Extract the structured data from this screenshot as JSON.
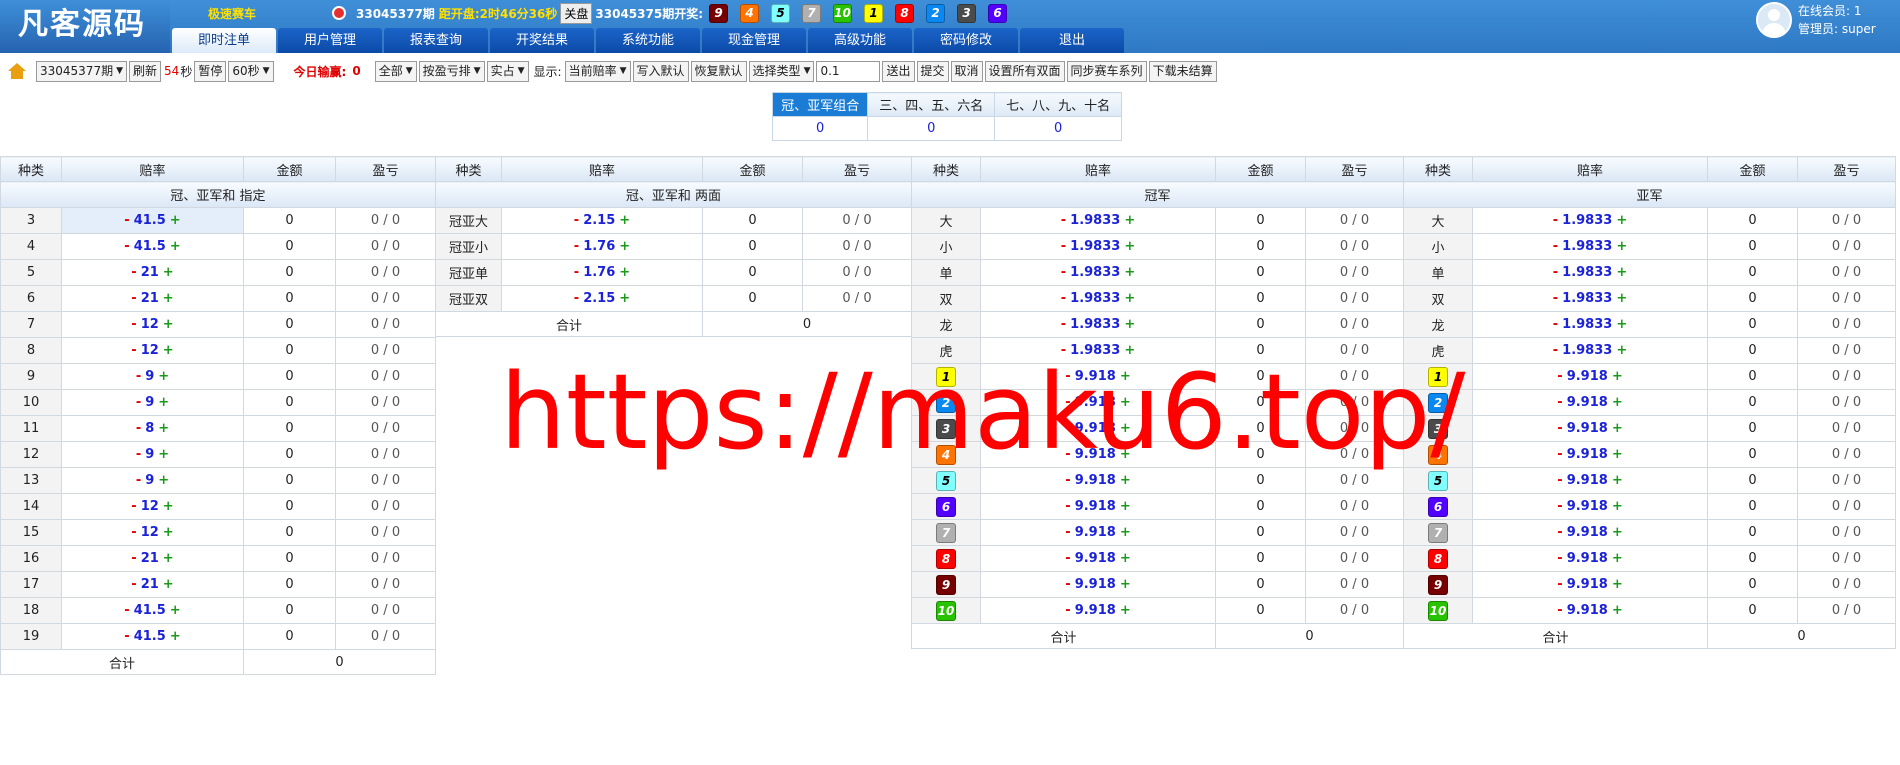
{
  "brand": {
    "logo_text": "凡客源码"
  },
  "infobar": {
    "game_name": "极速赛车",
    "current_period": "33045377期",
    "countdown_label": "距开盘:",
    "countdown": "2时46分36秒",
    "closed_badge": "关盘",
    "last_period": "33045375期开奖:",
    "last_result": [
      9,
      4,
      5,
      7,
      10,
      1,
      8,
      2,
      3,
      6
    ]
  },
  "tabs": [
    "即时注单",
    "用户管理",
    "报表查询",
    "开奖结果",
    "系统功能",
    "现金管理",
    "高级功能",
    "密码修改",
    "退出"
  ],
  "user": {
    "online": "在线会员: 1",
    "admin": "管理员: super"
  },
  "toolbar": {
    "period_select": "33045377期",
    "refresh": "刷新",
    "countdown_num": "54",
    "countdown_unit": "秒",
    "pause": "暂停",
    "interval_select": "60秒",
    "today_label": "今日输赢:",
    "today_value": "0",
    "scope_select": "全部",
    "sort_select": "按盈亏排",
    "mode_select": "实占",
    "display_label": "显示:",
    "odds_select": "当前赔率",
    "write_default": "写入默认",
    "restore_default": "恢复默认",
    "type_select": "选择类型",
    "step_value": "0.1",
    "send": "送出",
    "submit": "提交",
    "cancel": "取消",
    "set_all_double": "设置所有双面",
    "sync_series": "同步赛车系列",
    "download_unsettled": "下载未结算"
  },
  "summary": {
    "headers": [
      "冠、亚军组合",
      "三、四、五、六名",
      "七、八、九、十名"
    ],
    "values": [
      "0",
      "0",
      "0"
    ]
  },
  "columns": {
    "kind": "种类",
    "odds": "赔率",
    "amount": "金额",
    "pnl": "盈亏"
  },
  "total_label": "合计",
  "panels": [
    {
      "title": "冠、亚军和 指定",
      "total": "0",
      "rows": [
        {
          "k": "3",
          "o": "41.5",
          "a": "0",
          "w": "0 / 0"
        },
        {
          "k": "4",
          "o": "41.5",
          "a": "0",
          "w": "0 / 0"
        },
        {
          "k": "5",
          "o": "21",
          "a": "0",
          "w": "0 / 0"
        },
        {
          "k": "6",
          "o": "21",
          "a": "0",
          "w": "0 / 0"
        },
        {
          "k": "7",
          "o": "12",
          "a": "0",
          "w": "0 / 0"
        },
        {
          "k": "8",
          "o": "12",
          "a": "0",
          "w": "0 / 0"
        },
        {
          "k": "9",
          "o": "9",
          "a": "0",
          "w": "0 / 0"
        },
        {
          "k": "10",
          "o": "9",
          "a": "0",
          "w": "0 / 0"
        },
        {
          "k": "11",
          "o": "8",
          "a": "0",
          "w": "0 / 0"
        },
        {
          "k": "12",
          "o": "9",
          "a": "0",
          "w": "0 / 0"
        },
        {
          "k": "13",
          "o": "9",
          "a": "0",
          "w": "0 / 0"
        },
        {
          "k": "14",
          "o": "12",
          "a": "0",
          "w": "0 / 0"
        },
        {
          "k": "15",
          "o": "12",
          "a": "0",
          "w": "0 / 0"
        },
        {
          "k": "16",
          "o": "21",
          "a": "0",
          "w": "0 / 0"
        },
        {
          "k": "17",
          "o": "21",
          "a": "0",
          "w": "0 / 0"
        },
        {
          "k": "18",
          "o": "41.5",
          "a": "0",
          "w": "0 / 0"
        },
        {
          "k": "19",
          "o": "41.5",
          "a": "0",
          "w": "0 / 0"
        }
      ]
    },
    {
      "title": "冠、亚军和 两面",
      "total": "0",
      "rows": [
        {
          "k": "冠亚大",
          "o": "2.15",
          "a": "0",
          "w": "0 / 0"
        },
        {
          "k": "冠亚小",
          "o": "1.76",
          "a": "0",
          "w": "0 / 0"
        },
        {
          "k": "冠亚单",
          "o": "1.76",
          "a": "0",
          "w": "0 / 0"
        },
        {
          "k": "冠亚双",
          "o": "2.15",
          "a": "0",
          "w": "0 / 0"
        }
      ]
    },
    {
      "title": "冠军",
      "total": "0",
      "rows": [
        {
          "k": "大",
          "o": "1.9833",
          "a": "0",
          "w": "0 / 0"
        },
        {
          "k": "小",
          "o": "1.9833",
          "a": "0",
          "w": "0 / 0"
        },
        {
          "k": "单",
          "o": "1.9833",
          "a": "0",
          "w": "0 / 0"
        },
        {
          "k": "双",
          "o": "1.9833",
          "a": "0",
          "w": "0 / 0"
        },
        {
          "k": "龙",
          "o": "1.9833",
          "a": "0",
          "w": "0 / 0"
        },
        {
          "k": "虎",
          "o": "1.9833",
          "a": "0",
          "w": "0 / 0"
        },
        {
          "ball": 1,
          "o": "9.918",
          "a": "0",
          "w": "0 / 0"
        },
        {
          "ball": 2,
          "o": "9.918",
          "a": "0",
          "w": "0 / 0"
        },
        {
          "ball": 3,
          "o": "9.918",
          "a": "0",
          "w": "0 / 0"
        },
        {
          "ball": 4,
          "o": "9.918",
          "a": "0",
          "w": "0 / 0"
        },
        {
          "ball": 5,
          "o": "9.918",
          "a": "0",
          "w": "0 / 0"
        },
        {
          "ball": 6,
          "o": "9.918",
          "a": "0",
          "w": "0 / 0"
        },
        {
          "ball": 7,
          "o": "9.918",
          "a": "0",
          "w": "0 / 0"
        },
        {
          "ball": 8,
          "o": "9.918",
          "a": "0",
          "w": "0 / 0"
        },
        {
          "ball": 9,
          "o": "9.918",
          "a": "0",
          "w": "0 / 0"
        },
        {
          "ball": 10,
          "o": "9.918",
          "a": "0",
          "w": "0 / 0"
        }
      ]
    },
    {
      "title": "亚军",
      "total": "0",
      "rows": [
        {
          "k": "大",
          "o": "1.9833",
          "a": "0",
          "w": "0 / 0"
        },
        {
          "k": "小",
          "o": "1.9833",
          "a": "0",
          "w": "0 / 0"
        },
        {
          "k": "单",
          "o": "1.9833",
          "a": "0",
          "w": "0 / 0"
        },
        {
          "k": "双",
          "o": "1.9833",
          "a": "0",
          "w": "0 / 0"
        },
        {
          "k": "龙",
          "o": "1.9833",
          "a": "0",
          "w": "0 / 0"
        },
        {
          "k": "虎",
          "o": "1.9833",
          "a": "0",
          "w": "0 / 0"
        },
        {
          "ball": 1,
          "o": "9.918",
          "a": "0",
          "w": "0 / 0"
        },
        {
          "ball": 2,
          "o": "9.918",
          "a": "0",
          "w": "0 / 0"
        },
        {
          "ball": 3,
          "o": "9.918",
          "a": "0",
          "w": "0 / 0"
        },
        {
          "ball": 4,
          "o": "9.918",
          "a": "0",
          "w": "0 / 0"
        },
        {
          "ball": 5,
          "o": "9.918",
          "a": "0",
          "w": "0 / 0"
        },
        {
          "ball": 6,
          "o": "9.918",
          "a": "0",
          "w": "0 / 0"
        },
        {
          "ball": 7,
          "o": "9.918",
          "a": "0",
          "w": "0 / 0"
        },
        {
          "ball": 8,
          "o": "9.918",
          "a": "0",
          "w": "0 / 0"
        },
        {
          "ball": 9,
          "o": "9.918",
          "a": "0",
          "w": "0 / 0"
        },
        {
          "ball": 10,
          "o": "9.918",
          "a": "0",
          "w": "0 / 0"
        }
      ]
    }
  ],
  "watermark": "https://maku6.top/",
  "colors": {
    "header_blue": "#2f78c4",
    "tab_blue": "#0b4aa7",
    "odds_blue": "#1b22d8",
    "minus_red": "#e00000",
    "plus_green": "#1a9a1a",
    "watermark_red": "#ff0000"
  },
  "icons": {
    "home": "home-icon",
    "avatar": "user-avatar-icon",
    "game": "game-status-icon"
  }
}
